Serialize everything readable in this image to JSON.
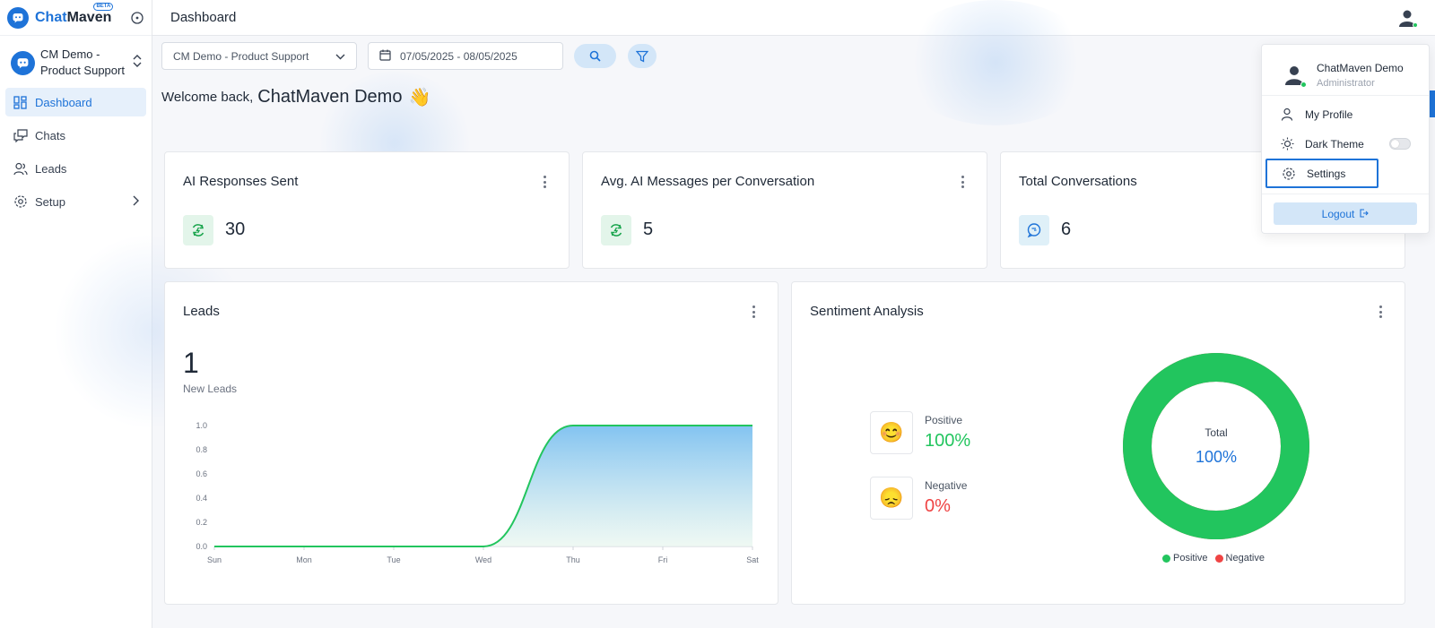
{
  "brand": {
    "name_a": "Chat",
    "name_b": "Maven",
    "badge": "BETA"
  },
  "workspace": {
    "name": "CM Demo - Product Support"
  },
  "sidebar": {
    "items": [
      {
        "label": "Dashboard",
        "icon": "dashboard-icon",
        "active": true
      },
      {
        "label": "Chats",
        "icon": "chats-icon"
      },
      {
        "label": "Leads",
        "icon": "users-icon"
      },
      {
        "label": "Setup",
        "icon": "gear-icon"
      }
    ]
  },
  "header": {
    "title": "Dashboard"
  },
  "filters": {
    "workspace_select": "CM Demo - Product Support",
    "date_range": "07/05/2025 - 08/05/2025"
  },
  "welcome": {
    "prefix": "Welcome back,",
    "name": "ChatMaven Demo",
    "emoji": "👋"
  },
  "stats": [
    {
      "title": "AI Responses Sent",
      "value": "30",
      "icon": "ai-refresh-icon"
    },
    {
      "title": "Avg. AI Messages per Conversation",
      "value": "5",
      "icon": "ai-refresh-icon"
    },
    {
      "title": "Total Conversations",
      "value": "6",
      "icon": "chat-bubble-icon"
    }
  ],
  "leads": {
    "title": "Leads",
    "count": "1",
    "label": "New Leads"
  },
  "chart_data": {
    "type": "area",
    "categories": [
      "Sun",
      "Mon",
      "Tue",
      "Wed",
      "Thu",
      "Fri",
      "Sat"
    ],
    "values": [
      0,
      0,
      0,
      0,
      1,
      1,
      1
    ],
    "yticks": [
      "1.0",
      "0.8",
      "0.6",
      "0.4",
      "0.2",
      "0.0"
    ],
    "ylim": [
      0,
      1
    ],
    "line_color": "#22c55e",
    "fill_color": "#7cc0f0"
  },
  "sentiment": {
    "title": "Sentiment Analysis",
    "positive": {
      "label": "Positive",
      "value": "100%",
      "emoji": "😊",
      "color": "#22c55e"
    },
    "negative": {
      "label": "Negative",
      "value": "0%",
      "emoji": "😞",
      "color": "#ef4444"
    },
    "donut": {
      "label": "Total",
      "value": "100%",
      "positive_fraction": 1.0
    },
    "legend": [
      "Positive",
      "Negative"
    ]
  },
  "profile_menu": {
    "name": "ChatMaven Demo",
    "role": "Administrator",
    "items": [
      "My Profile",
      "Dark Theme",
      "Settings"
    ],
    "logout": "Logout"
  }
}
